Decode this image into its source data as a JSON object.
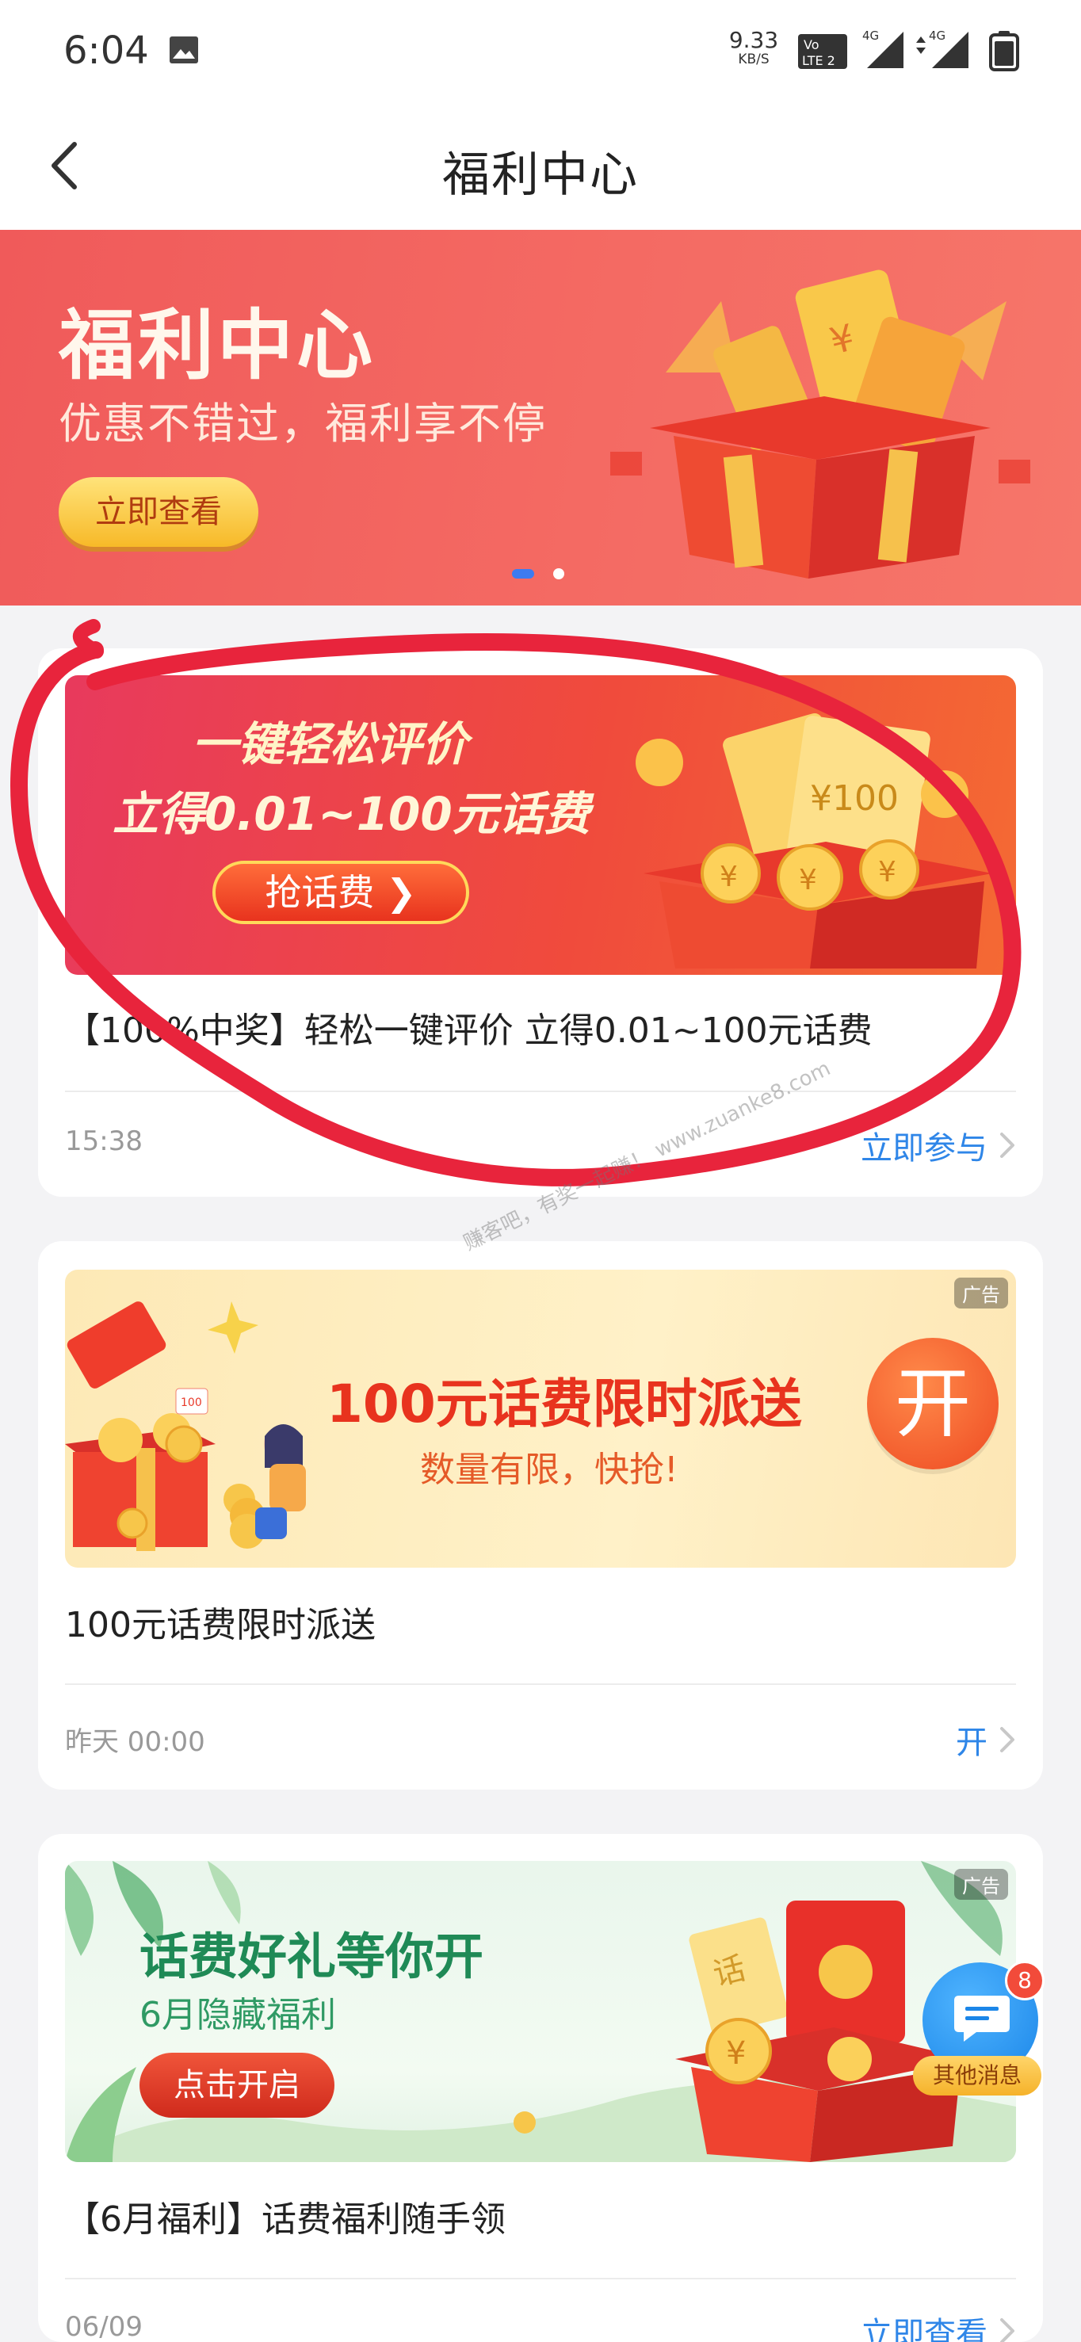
{
  "status_bar": {
    "time": "6:04",
    "net_speed_value": "9.33",
    "net_speed_unit": "KB/S",
    "icons": [
      "gallery-icon",
      "volte-icon",
      "signal-4g-icon",
      "signal-4g-icon",
      "battery-icon"
    ]
  },
  "nav": {
    "title": "福利中心",
    "back_icon": "chevron-left-icon"
  },
  "hero": {
    "title": "福利中心",
    "subtitle": "优惠不错过，福利享不停",
    "button_label": "立即查看",
    "active_slide": 1,
    "slide_count": 2
  },
  "cards": [
    {
      "banner": {
        "line1": "一键轻松评价",
        "line2": "立得0.01~100元话费",
        "button_label": "抢话费 ❯"
      },
      "title": "【100%中奖】轻松一键评价 立得0.01~100元话费",
      "time": "15:38",
      "action_label": "立即参与"
    },
    {
      "banner": {
        "ad_label": "广告",
        "line1": "100元话费限时派送",
        "line2": "数量有限，快抢!",
        "open_label": "开"
      },
      "title": "100元话费限时派送",
      "time": "昨天 00:00",
      "action_label": "开"
    },
    {
      "banner": {
        "ad_label": "广告",
        "line1": "话费好礼等你开",
        "line2": "6月隐藏福利",
        "button_label": "点击开启"
      },
      "title": "【6月福利】话费福利随手领",
      "time": "06/09",
      "action_label": "立即查看"
    }
  ],
  "float_chat": {
    "badge_count": "8",
    "label": "其他消息"
  },
  "watermark": "赚客吧，有奖一起赚！ www.zuanke8.com",
  "colors": {
    "accent_blue": "#2f86e8",
    "hero_red": "#f05a5a",
    "annotation_red": "#e8243c"
  }
}
